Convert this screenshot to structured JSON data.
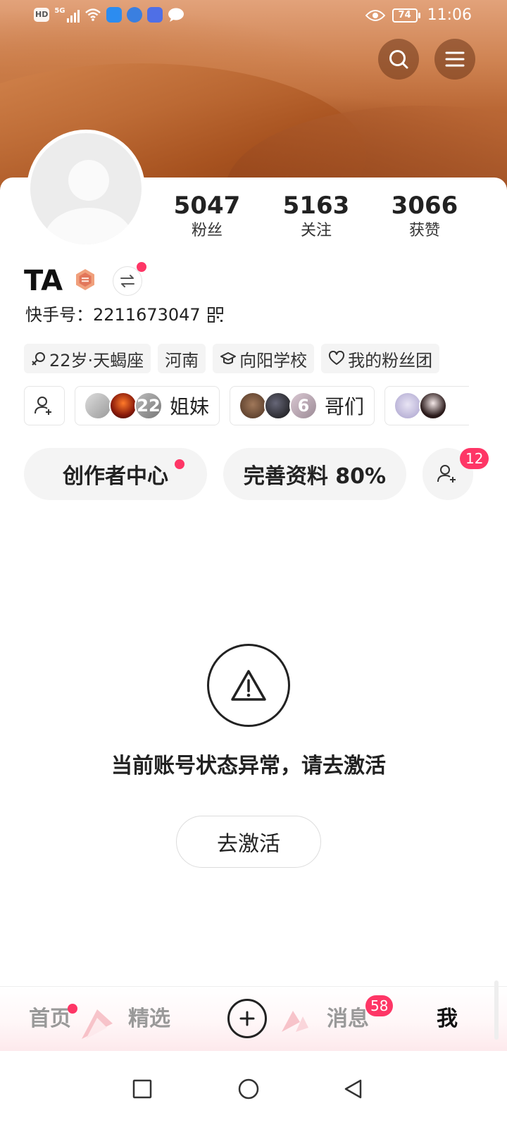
{
  "status_bar": {
    "hd_label": "HD",
    "network_label": "5G",
    "battery": "74",
    "time": "11:06"
  },
  "header": {
    "search_icon": "search-icon",
    "menu_icon": "menu-icon"
  },
  "profile": {
    "name": "TA",
    "kuaishou_id_label": "快手号：",
    "kuaishou_id": "2211673047",
    "stats": [
      {
        "value": "5047",
        "label": "粉丝"
      },
      {
        "value": "5163",
        "label": "关注"
      },
      {
        "value": "3066",
        "label": "获赞"
      }
    ],
    "tags": [
      {
        "icon": "female-icon",
        "text": "22岁·天蝎座"
      },
      {
        "icon": "",
        "text": "河南"
      },
      {
        "icon": "graduation-cap-icon",
        "text": "向阳学校"
      },
      {
        "icon": "heart-icon",
        "text": "我的粉丝团"
      }
    ],
    "groups": [
      {
        "name": "姐妹",
        "count_overlay": "22"
      },
      {
        "name": "哥们",
        "count_overlay": "6"
      },
      {
        "name": "",
        "count_overlay": ""
      }
    ]
  },
  "actions": {
    "creator_center": "创作者中心",
    "complete_profile": "完善资料 80%",
    "friend_request_count": "12"
  },
  "notice": {
    "message": "当前账号状态异常，请去激活",
    "button": "去激活"
  },
  "tabbar": {
    "home": "首页",
    "featured": "精选",
    "messages": "消息",
    "messages_badge": "58",
    "me": "我"
  },
  "colors": {
    "accent_red": "#fe3666",
    "text_primary": "#222222",
    "tab_inactive": "#999999"
  }
}
